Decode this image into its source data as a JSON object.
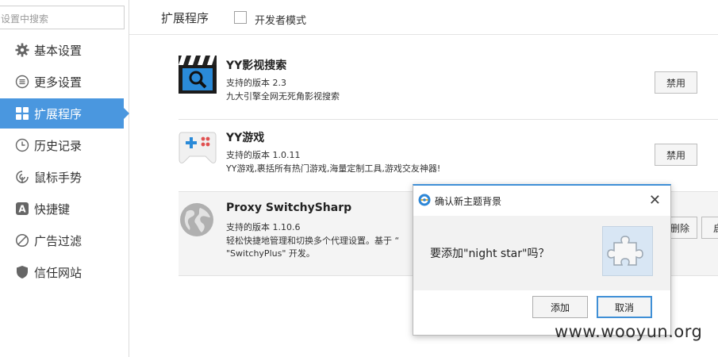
{
  "sidebar": {
    "search_placeholder": "设置中搜索",
    "items": [
      {
        "label": "基本设置",
        "icon": "gear-icon"
      },
      {
        "label": "更多设置",
        "icon": "list-icon"
      },
      {
        "label": "扩展程序",
        "icon": "grid-icon"
      },
      {
        "label": "历史记录",
        "icon": "clock-icon"
      },
      {
        "label": "鼠标手势",
        "icon": "mouse-gesture-icon"
      },
      {
        "label": "快捷键",
        "icon": "letter-a-icon"
      },
      {
        "label": "广告过滤",
        "icon": "block-icon"
      },
      {
        "label": "信任网站",
        "icon": "shield-icon"
      }
    ],
    "active_index": 2,
    "accent_color": "#4a97df"
  },
  "header": {
    "title": "扩展程序",
    "dev_mode_label": "开发者模式",
    "dev_mode_checked": false
  },
  "extensions": [
    {
      "name": "YY影视搜索",
      "version": "支持的版本 2.3",
      "description": "九大引擎全网无死角影视搜索",
      "button": "禁用",
      "icon": "clapperboard-search-icon"
    },
    {
      "name": "YY游戏",
      "version": "支持的版本 1.0.11",
      "description": "YY游戏,裹括所有热门游戏,海量定制工具,游戏交友神器!",
      "button": "禁用",
      "icon": "gamepad-icon"
    },
    {
      "name": "Proxy SwitchySharp",
      "version": "支持的版本 1.10.6",
      "description_line1": "轻松快捷地管理和切换多个代理设置。基于 “",
      "description_line2": "\"SwitchyPlus\" 开发。",
      "button_delete": "删除",
      "button_partial": "启",
      "icon": "globe-icon"
    }
  ],
  "dialog": {
    "title": "确认新主题背景",
    "message": "要添加\"night star\"吗？",
    "add_button": "添加",
    "cancel_button": "取消",
    "close_symbol": "✕",
    "accent_color": "#3f8fd6"
  },
  "watermark": "www.wooyun.org"
}
